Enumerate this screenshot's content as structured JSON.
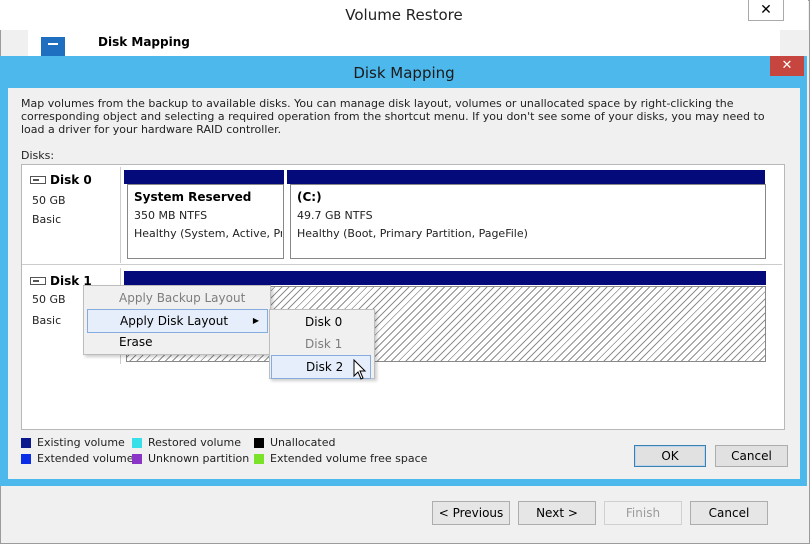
{
  "background_window": {
    "title": "Volume Restore",
    "close_glyph": "✕",
    "header_title": "Disk Mapping",
    "buttons": {
      "previous": "< Previous",
      "next": "Next >",
      "finish": "Finish",
      "cancel": "Cancel"
    }
  },
  "dialog": {
    "title": "Disk Mapping",
    "close_glyph": "✕",
    "description": "Map volumes from the backup to available disks. You can manage disk layout, volumes or unallocated space by right-clicking the corresponding object and selecting a required operation from the shortcut menu. If you don't see some of your disks, you may need to load a driver for your hardware RAID controller.",
    "disks_label": "Disks:",
    "disks": [
      {
        "name": "Disk 0",
        "size": "50 GB",
        "type": "Basic",
        "volumes": [
          {
            "title": "System Reserved",
            "size": "350 MB NTFS",
            "status": "Healthy (System, Active, Primary Partition)"
          },
          {
            "title": "(C:)",
            "size": "49.7 GB NTFS",
            "status": "Healthy (Boot, Primary Partition, PageFile)"
          }
        ]
      },
      {
        "name": "Disk 1",
        "size": "50 GB",
        "type": "Basic"
      }
    ],
    "context_menu": {
      "items": [
        {
          "label": "Apply Backup Layout",
          "enabled": false
        },
        {
          "label": "Apply Disk Layout",
          "enabled": true,
          "highlighted": true,
          "has_submenu": true
        },
        {
          "label": "Erase",
          "enabled": true
        }
      ],
      "submenu_arrow": "▶",
      "submenu": [
        {
          "label": "Disk 0",
          "enabled": true
        },
        {
          "label": "Disk 1",
          "enabled": false
        },
        {
          "label": "Disk 2",
          "enabled": true,
          "highlighted": true
        }
      ]
    },
    "legend": [
      {
        "label": "Existing volume",
        "color": "#0a1a8c"
      },
      {
        "label": "Restored volume",
        "color": "#37e0e8"
      },
      {
        "label": "Unallocated",
        "color": "#000000"
      },
      {
        "label": "Extended volume",
        "color": "#0a2ee8"
      },
      {
        "label": "Unknown partition",
        "color": "#8b34c8"
      },
      {
        "label": "Extended volume free space",
        "color": "#7be22a"
      }
    ],
    "buttons": {
      "ok": "OK",
      "cancel": "Cancel"
    }
  }
}
